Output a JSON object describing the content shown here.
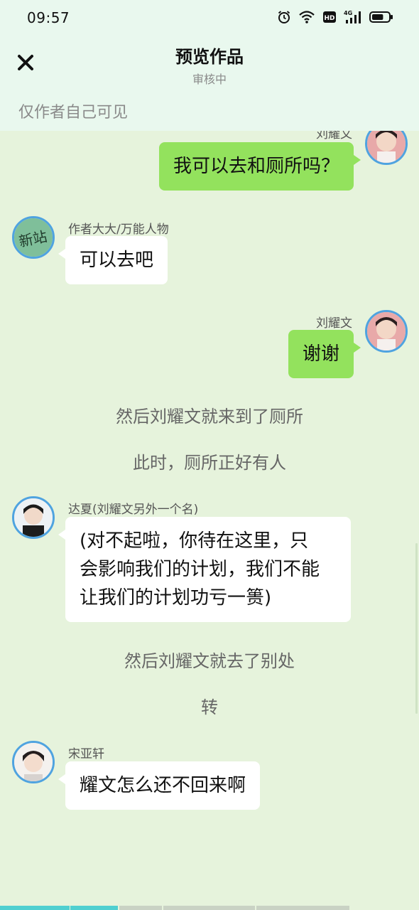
{
  "status_bar": {
    "time": "09:57",
    "icons": [
      "alarm-icon",
      "wifi-icon",
      "hd-icon",
      "signal-4g-icon",
      "battery-icon"
    ],
    "network_label": "4G",
    "hd_label": "HD",
    "battery_level": 0.7
  },
  "header": {
    "title": "预览作品",
    "subtitle": "审核中",
    "close_icon": "close-icon",
    "visibility_note": "仅作者自己可见"
  },
  "messages": [
    {
      "type": "right",
      "name": "刘耀文",
      "text": "我可以去和厕所吗？",
      "avatar": "avatar-liuyaowen"
    },
    {
      "type": "left",
      "name": "作者大大/万能人物",
      "text": "可以去吧",
      "avatar": "avatar-author"
    },
    {
      "type": "right",
      "name": "刘耀文",
      "text": "谢谢",
      "avatar": "avatar-liuyaowen"
    },
    {
      "type": "narration",
      "text": "然后刘耀文就来到了厕所"
    },
    {
      "type": "narration",
      "text": "此时，厕所正好有人"
    },
    {
      "type": "left",
      "name": "达夏(刘耀文另外一个名)",
      "lines": [
        "(对不起啦，你待在这里，只",
        "会影响我们的计划，我们不能",
        "让我们的计划功亏一篑)"
      ],
      "avatar": "avatar-daxia"
    },
    {
      "type": "narration",
      "text": "然后刘耀文就去了别处"
    },
    {
      "type": "narration",
      "text": "转"
    },
    {
      "type": "left",
      "name": "宋亚轩",
      "text": "耀文怎么还不回来啊",
      "avatar": "avatar-songyaxuan"
    }
  ],
  "avatar_text": {
    "author": "新站"
  },
  "colors": {
    "background": "#e6f3dc",
    "header_bg": "#e9f8ee",
    "right_bubble": "#93e25d",
    "left_bubble": "#ffffff",
    "avatar_ring": "#4fa3e0"
  },
  "progress_segments": [
    {
      "state": "done",
      "color": "#4fcfd0"
    },
    {
      "state": "current",
      "color": "#4fcfd0"
    },
    {
      "state": "pending",
      "color": "#c9d2c4"
    },
    {
      "state": "pending",
      "color": "#c9d2c4"
    },
    {
      "state": "pending",
      "color": "#c9d2c4"
    }
  ]
}
